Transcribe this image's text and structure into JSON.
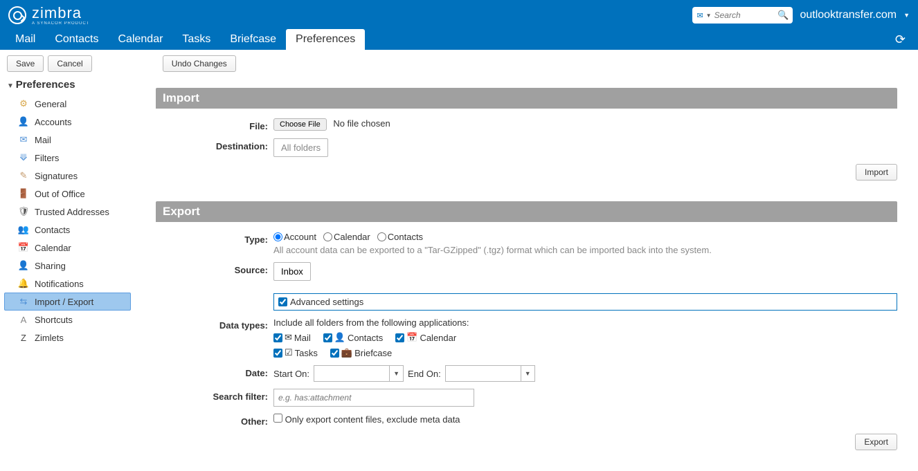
{
  "brand": {
    "name": "zimbra",
    "subtitle": "A SYNACOR PRODUCT",
    "site": "outlooktransfer.com"
  },
  "search": {
    "placeholder": "Search"
  },
  "tabs": [
    "Mail",
    "Contacts",
    "Calendar",
    "Tasks",
    "Briefcase",
    "Preferences"
  ],
  "activeTab": "Preferences",
  "toolbar": {
    "save": "Save",
    "cancel": "Cancel",
    "undo": "Undo Changes"
  },
  "sidebar": {
    "heading": "Preferences",
    "items": [
      {
        "label": "General",
        "icon": "⚙",
        "color": "#d8a84c"
      },
      {
        "label": "Accounts",
        "icon": "👤",
        "color": "#4d8fd6"
      },
      {
        "label": "Mail",
        "icon": "✉",
        "color": "#4d8fd6"
      },
      {
        "label": "Filters",
        "icon": "⟱",
        "color": "#4d8fd6"
      },
      {
        "label": "Signatures",
        "icon": "✎",
        "color": "#c49a6c"
      },
      {
        "label": "Out of Office",
        "icon": "🚪",
        "color": "#6b6b6b"
      },
      {
        "label": "Trusted Addresses",
        "icon": "🛡",
        "color": "#5a5a5a"
      },
      {
        "label": "Contacts",
        "icon": "👥",
        "color": "#4d8fd6"
      },
      {
        "label": "Calendar",
        "icon": "📅",
        "color": "#4d8fd6"
      },
      {
        "label": "Sharing",
        "icon": "👤",
        "color": "#e08f3a"
      },
      {
        "label": "Notifications",
        "icon": "🔔",
        "color": "#d8a84c"
      },
      {
        "label": "Import / Export",
        "icon": "⇆",
        "color": "#4d8fd6"
      },
      {
        "label": "Shortcuts",
        "icon": "A",
        "color": "#888"
      },
      {
        "label": "Zimlets",
        "icon": "Z",
        "color": "#444"
      }
    ],
    "selected": "Import / Export"
  },
  "import": {
    "heading": "Import",
    "fileLabel": "File:",
    "chooseFile": "Choose File",
    "noFile": "No file chosen",
    "destLabel": "Destination:",
    "destValue": "All folders",
    "button": "Import"
  },
  "export": {
    "heading": "Export",
    "typeLabel": "Type:",
    "types": {
      "account": "Account",
      "calendar": "Calendar",
      "contacts": "Contacts"
    },
    "typeSelected": "account",
    "typeNote": "All account data can be exported to a \"Tar-GZipped\" (.tgz) format which can be imported back into the system.",
    "sourceLabel": "Source:",
    "sourceValue": "Inbox",
    "advanced": "Advanced settings",
    "advancedChecked": true,
    "dataTypesLabel": "Data types:",
    "dataTypesNote": "Include all folders from the following applications:",
    "dataTypes": [
      {
        "label": "Mail",
        "icon": "✉",
        "checked": true
      },
      {
        "label": "Contacts",
        "icon": "👤",
        "checked": true
      },
      {
        "label": "Calendar",
        "icon": "📅",
        "checked": true
      },
      {
        "label": "Tasks",
        "icon": "☑",
        "checked": true
      },
      {
        "label": "Briefcase",
        "icon": "💼",
        "checked": true
      }
    ],
    "dateLabel": "Date:",
    "startOn": "Start On:",
    "endOn": "End On:",
    "searchFilterLabel": "Search filter:",
    "searchFilterPlaceholder": "e.g. has:attachment",
    "otherLabel": "Other:",
    "otherOption": "Only export content files, exclude meta data",
    "button": "Export"
  }
}
